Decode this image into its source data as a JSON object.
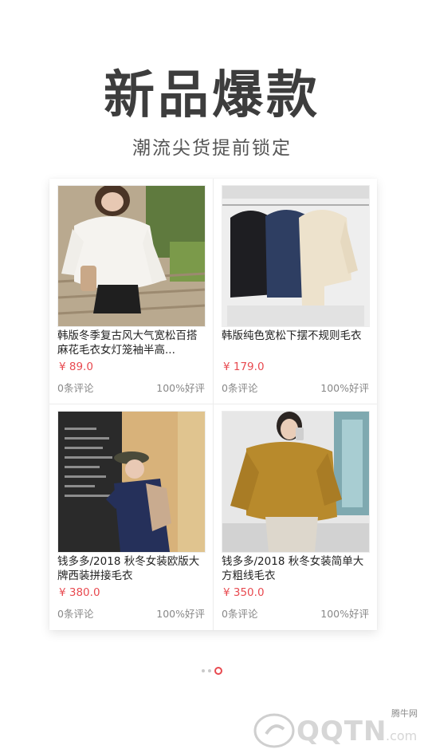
{
  "hero": {
    "title": "新品爆款",
    "subtitle": "潮流尖货提前锁定"
  },
  "products": [
    {
      "name": "韩版冬季复古风大气宽松百搭麻花毛衣女灯笼袖半高...",
      "price": "¥ 89.0",
      "comments": "0条评论",
      "rating": "100%好评",
      "image_icon": "white-sweater-photo"
    },
    {
      "name": "韩版纯色宽松下摆不规则毛衣",
      "price": "¥ 179.0",
      "comments": "0条评论",
      "rating": "100%好评",
      "image_icon": "hanging-sweaters-photo"
    },
    {
      "name": "钱多多/2018 秋冬女装欧版大牌西装拼接毛衣",
      "price": "¥ 380.0",
      "comments": "0条评论",
      "rating": "100%好评",
      "image_icon": "blazer-sweater-photo"
    },
    {
      "name": "钱多多/2018 秋冬女装简单大方粗线毛衣",
      "price": "¥ 350.0",
      "comments": "0条评论",
      "rating": "100%好评",
      "image_icon": "mustard-sweater-photo"
    }
  ],
  "pager": {
    "total": 3,
    "active": 2
  },
  "watermark": {
    "brand": "QQTN.com",
    "tag": "腾牛网"
  },
  "colors": {
    "price": "#e84a50",
    "title": "#3d3d3d",
    "muted": "#888888"
  }
}
